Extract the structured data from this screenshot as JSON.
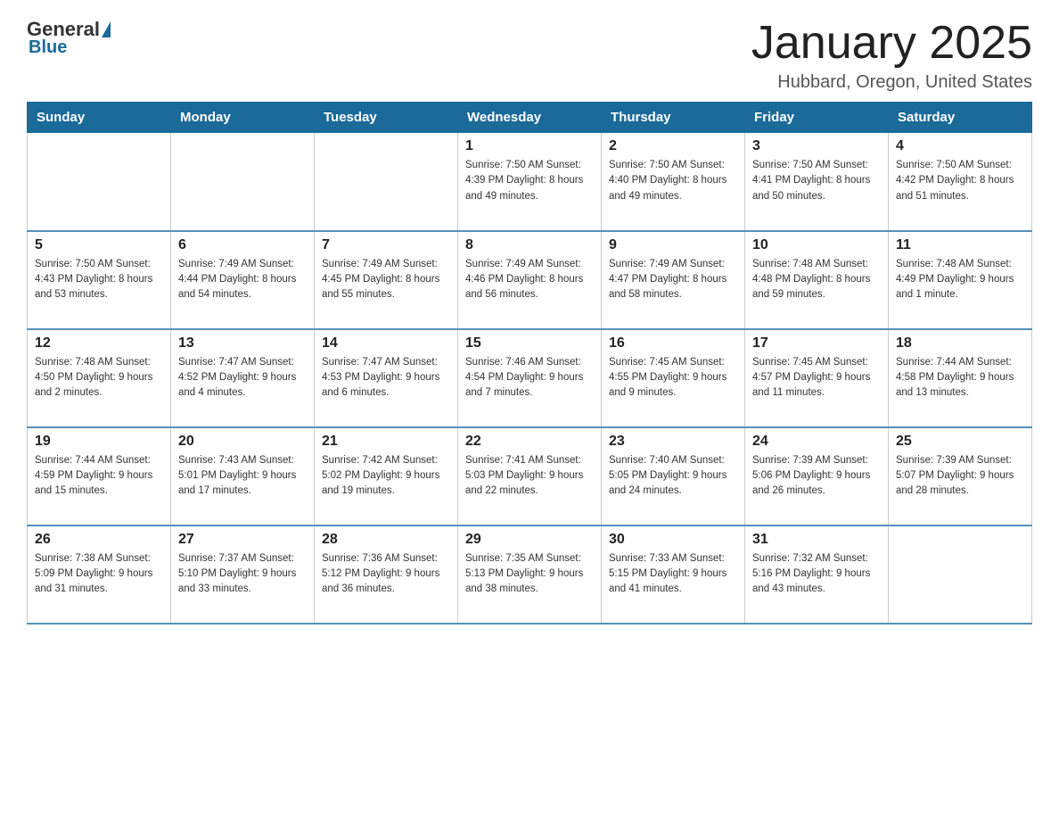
{
  "header": {
    "logo_general": "General",
    "logo_blue": "Blue",
    "title": "January 2025",
    "location": "Hubbard, Oregon, United States"
  },
  "days_of_week": [
    "Sunday",
    "Monday",
    "Tuesday",
    "Wednesday",
    "Thursday",
    "Friday",
    "Saturday"
  ],
  "weeks": [
    [
      {
        "day": "",
        "info": ""
      },
      {
        "day": "",
        "info": ""
      },
      {
        "day": "",
        "info": ""
      },
      {
        "day": "1",
        "info": "Sunrise: 7:50 AM\nSunset: 4:39 PM\nDaylight: 8 hours\nand 49 minutes."
      },
      {
        "day": "2",
        "info": "Sunrise: 7:50 AM\nSunset: 4:40 PM\nDaylight: 8 hours\nand 49 minutes."
      },
      {
        "day": "3",
        "info": "Sunrise: 7:50 AM\nSunset: 4:41 PM\nDaylight: 8 hours\nand 50 minutes."
      },
      {
        "day": "4",
        "info": "Sunrise: 7:50 AM\nSunset: 4:42 PM\nDaylight: 8 hours\nand 51 minutes."
      }
    ],
    [
      {
        "day": "5",
        "info": "Sunrise: 7:50 AM\nSunset: 4:43 PM\nDaylight: 8 hours\nand 53 minutes."
      },
      {
        "day": "6",
        "info": "Sunrise: 7:49 AM\nSunset: 4:44 PM\nDaylight: 8 hours\nand 54 minutes."
      },
      {
        "day": "7",
        "info": "Sunrise: 7:49 AM\nSunset: 4:45 PM\nDaylight: 8 hours\nand 55 minutes."
      },
      {
        "day": "8",
        "info": "Sunrise: 7:49 AM\nSunset: 4:46 PM\nDaylight: 8 hours\nand 56 minutes."
      },
      {
        "day": "9",
        "info": "Sunrise: 7:49 AM\nSunset: 4:47 PM\nDaylight: 8 hours\nand 58 minutes."
      },
      {
        "day": "10",
        "info": "Sunrise: 7:48 AM\nSunset: 4:48 PM\nDaylight: 8 hours\nand 59 minutes."
      },
      {
        "day": "11",
        "info": "Sunrise: 7:48 AM\nSunset: 4:49 PM\nDaylight: 9 hours\nand 1 minute."
      }
    ],
    [
      {
        "day": "12",
        "info": "Sunrise: 7:48 AM\nSunset: 4:50 PM\nDaylight: 9 hours\nand 2 minutes."
      },
      {
        "day": "13",
        "info": "Sunrise: 7:47 AM\nSunset: 4:52 PM\nDaylight: 9 hours\nand 4 minutes."
      },
      {
        "day": "14",
        "info": "Sunrise: 7:47 AM\nSunset: 4:53 PM\nDaylight: 9 hours\nand 6 minutes."
      },
      {
        "day": "15",
        "info": "Sunrise: 7:46 AM\nSunset: 4:54 PM\nDaylight: 9 hours\nand 7 minutes."
      },
      {
        "day": "16",
        "info": "Sunrise: 7:45 AM\nSunset: 4:55 PM\nDaylight: 9 hours\nand 9 minutes."
      },
      {
        "day": "17",
        "info": "Sunrise: 7:45 AM\nSunset: 4:57 PM\nDaylight: 9 hours\nand 11 minutes."
      },
      {
        "day": "18",
        "info": "Sunrise: 7:44 AM\nSunset: 4:58 PM\nDaylight: 9 hours\nand 13 minutes."
      }
    ],
    [
      {
        "day": "19",
        "info": "Sunrise: 7:44 AM\nSunset: 4:59 PM\nDaylight: 9 hours\nand 15 minutes."
      },
      {
        "day": "20",
        "info": "Sunrise: 7:43 AM\nSunset: 5:01 PM\nDaylight: 9 hours\nand 17 minutes."
      },
      {
        "day": "21",
        "info": "Sunrise: 7:42 AM\nSunset: 5:02 PM\nDaylight: 9 hours\nand 19 minutes."
      },
      {
        "day": "22",
        "info": "Sunrise: 7:41 AM\nSunset: 5:03 PM\nDaylight: 9 hours\nand 22 minutes."
      },
      {
        "day": "23",
        "info": "Sunrise: 7:40 AM\nSunset: 5:05 PM\nDaylight: 9 hours\nand 24 minutes."
      },
      {
        "day": "24",
        "info": "Sunrise: 7:39 AM\nSunset: 5:06 PM\nDaylight: 9 hours\nand 26 minutes."
      },
      {
        "day": "25",
        "info": "Sunrise: 7:39 AM\nSunset: 5:07 PM\nDaylight: 9 hours\nand 28 minutes."
      }
    ],
    [
      {
        "day": "26",
        "info": "Sunrise: 7:38 AM\nSunset: 5:09 PM\nDaylight: 9 hours\nand 31 minutes."
      },
      {
        "day": "27",
        "info": "Sunrise: 7:37 AM\nSunset: 5:10 PM\nDaylight: 9 hours\nand 33 minutes."
      },
      {
        "day": "28",
        "info": "Sunrise: 7:36 AM\nSunset: 5:12 PM\nDaylight: 9 hours\nand 36 minutes."
      },
      {
        "day": "29",
        "info": "Sunrise: 7:35 AM\nSunset: 5:13 PM\nDaylight: 9 hours\nand 38 minutes."
      },
      {
        "day": "30",
        "info": "Sunrise: 7:33 AM\nSunset: 5:15 PM\nDaylight: 9 hours\nand 41 minutes."
      },
      {
        "day": "31",
        "info": "Sunrise: 7:32 AM\nSunset: 5:16 PM\nDaylight: 9 hours\nand 43 minutes."
      },
      {
        "day": "",
        "info": ""
      }
    ]
  ]
}
